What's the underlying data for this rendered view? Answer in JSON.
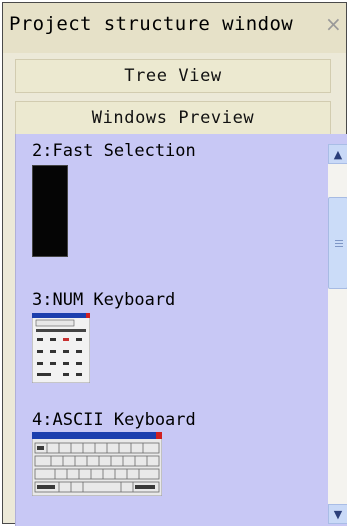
{
  "window": {
    "title": "Project structure window",
    "close_glyph": "×"
  },
  "buttons": {
    "tree_view": "Tree View",
    "windows_preview": "Windows Preview"
  },
  "preview_items": [
    {
      "label": "2:Fast Selection",
      "thumb_icon": "black-window-thumbnail-icon"
    },
    {
      "label": "3:NUM Keyboard",
      "thumb_icon": "numeric-keypad-thumbnail-icon"
    },
    {
      "label": "4:ASCII Keyboard",
      "thumb_icon": "ascii-keyboard-thumbnail-icon"
    }
  ],
  "scrollbar": {
    "up_glyph": "▲",
    "down_glyph": "▼"
  },
  "colors": {
    "title_bg": "#e6e1c8",
    "preview_bg": "#c8c8f5",
    "scroll_button": "#c9d9f7"
  }
}
